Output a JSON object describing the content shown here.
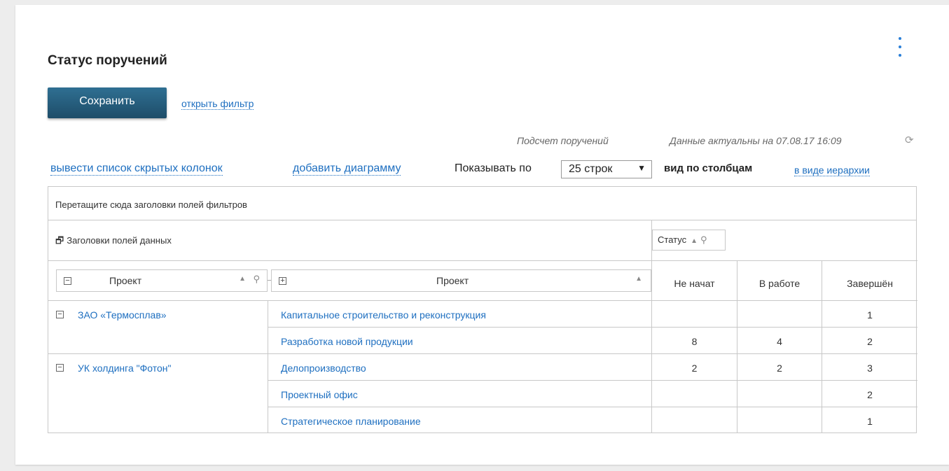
{
  "page": {
    "title": "Статус поручений",
    "save_label": "Сохранить",
    "filter_link": "открыть фильтр",
    "count_label": "Подсчет поручений",
    "actual_label": "Данные актуальны на 07.08.17 16:09"
  },
  "toolbar": {
    "hidden_columns": "вывести список скрытых колонок",
    "add_chart": "добавить диаграмму",
    "show_by": "Показывать по",
    "rows_value": "25 строк",
    "view_columns": "вид по столбцам",
    "view_hierarchy": "в виде иерархии"
  },
  "pivot": {
    "filter_drop": "Перетащите сюда заголовки полей фильтров",
    "data_headers": "Заголовки полей данных",
    "column_field": "Статус",
    "row_field_1": "Проект",
    "row_field_2": "Проект",
    "columns": [
      "Не начат",
      "В работе",
      "Завершён"
    ],
    "groups": [
      {
        "name": "ЗАО «Термосплав»",
        "rows": [
          {
            "project": "Капитальное строительство и реконструкция",
            "values": [
              "",
              "",
              "1"
            ]
          },
          {
            "project": "Разработка новой продукции",
            "values": [
              "8",
              "4",
              "2"
            ]
          }
        ]
      },
      {
        "name": "УК холдинга \"Фотон\"",
        "rows": [
          {
            "project": "Делопроизводство",
            "values": [
              "2",
              "2",
              "3"
            ]
          },
          {
            "project": "Проектный офис",
            "values": [
              "",
              "",
              "2"
            ]
          },
          {
            "project": "Стратегическое планирование",
            "values": [
              "",
              "",
              "1"
            ]
          }
        ]
      }
    ]
  },
  "icons": {
    "menu": "more-vertical-icon",
    "refresh": "refresh-icon",
    "collapse": "minus-box-icon",
    "expand": "plus-box-icon",
    "pin": "filter-pin-icon",
    "sort": "sort-asc-icon"
  },
  "colors": {
    "link": "#1e6fc0",
    "button": "#1e4d69",
    "accent_dots": "#2a7fd8"
  }
}
